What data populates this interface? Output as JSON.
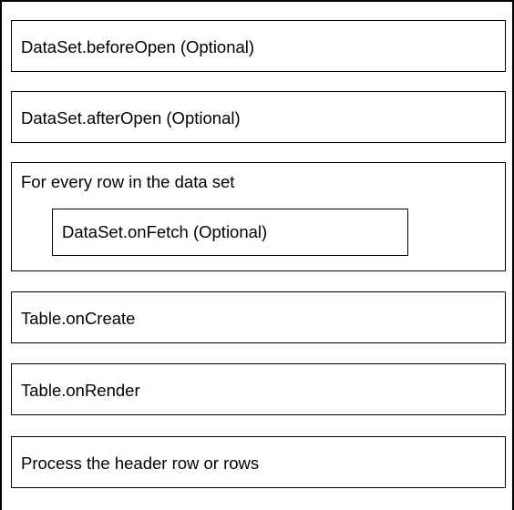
{
  "diagram": {
    "steps": [
      {
        "label": "DataSet.beforeOpen (Optional)"
      },
      {
        "label": "DataSet.afterOpen (Optional)"
      },
      {
        "label": "For every row in the data set",
        "child": {
          "label": "DataSet.onFetch (Optional)"
        }
      },
      {
        "label": "Table.onCreate"
      },
      {
        "label": "Table.onRender"
      },
      {
        "label": "Process the header row or rows"
      }
    ]
  }
}
